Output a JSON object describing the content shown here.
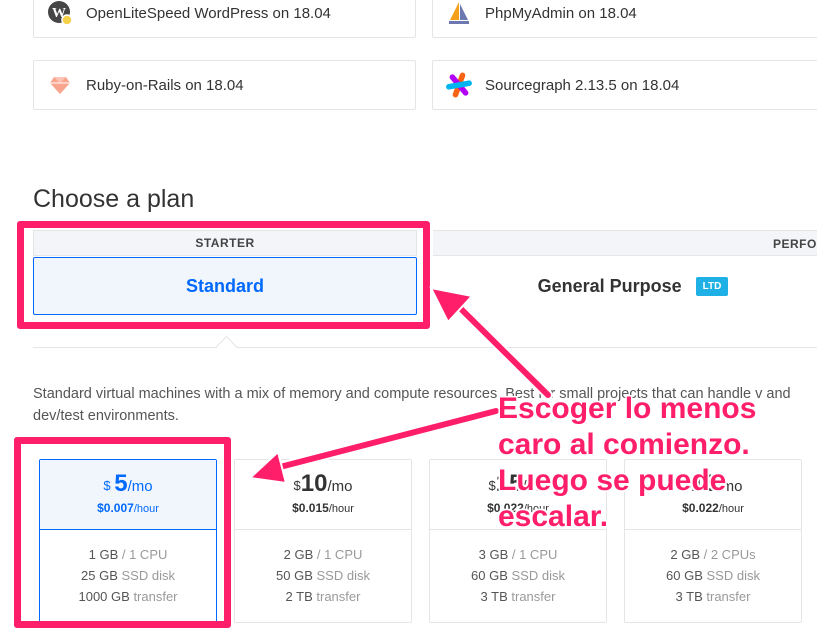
{
  "apps": [
    {
      "label": "OpenLiteSpeed WordPress on 18.04",
      "icon": "wordpress-icon"
    },
    {
      "label": "PhpMyAdmin on 18.04",
      "icon": "sailboat-icon"
    },
    {
      "label": "Ruby-on-Rails on 18.04",
      "icon": "ruby-gem-icon"
    },
    {
      "label": "Sourcegraph 2.13.5 on 18.04",
      "icon": "sourcegraph-icon"
    }
  ],
  "section_title": "Choose a plan",
  "tabs": {
    "starter": {
      "head": "STARTER",
      "name": "Standard"
    },
    "performance": {
      "head": "PERFO",
      "name": "General Purpose",
      "badge": "LTD"
    }
  },
  "description": "Standard virtual machines with a mix of memory and compute resources. Best for small projects that can handle v and dev/test environments.",
  "plans": [
    {
      "currency": "$",
      "amount": "5",
      "per": "/mo",
      "hourly": "$0.007",
      "hour_unit": "/hour",
      "ram": "1 GB",
      "cpu": "/ 1 CPU",
      "disk": "25 GB",
      "disk_unit": "SSD disk",
      "transfer": "1000 GB",
      "transfer_unit": "transfer"
    },
    {
      "currency": "$",
      "amount": "10",
      "per": "/mo",
      "hourly": "$0.015",
      "hour_unit": "/hour",
      "ram": "2 GB",
      "cpu": "/ 1 CPU",
      "disk": "50 GB",
      "disk_unit": "SSD disk",
      "transfer": "2 TB",
      "transfer_unit": "transfer"
    },
    {
      "currency": "$",
      "amount": "15",
      "per": "/mo",
      "hourly": "$0.022",
      "hour_unit": "/hour",
      "ram": "3 GB",
      "cpu": "/ 1 CPU",
      "disk": "60 GB",
      "disk_unit": "SSD disk",
      "transfer": "3 TB",
      "transfer_unit": "transfer"
    },
    {
      "currency": "$",
      "amount": "15",
      "per": "/mo",
      "hourly": "$0.022",
      "hour_unit": "/hour",
      "ram": "2 GB",
      "cpu": "/ 2 CPUs",
      "disk": "60 GB",
      "disk_unit": "SSD disk",
      "transfer": "3 TB",
      "transfer_unit": "transfer"
    }
  ],
  "annotation": "Escoger lo menos caro al comienzo. Luego se puede escalar.",
  "colors": {
    "accent": "#0069ff",
    "annotation": "#ff1e6a",
    "badge": "#1fb1e6"
  }
}
